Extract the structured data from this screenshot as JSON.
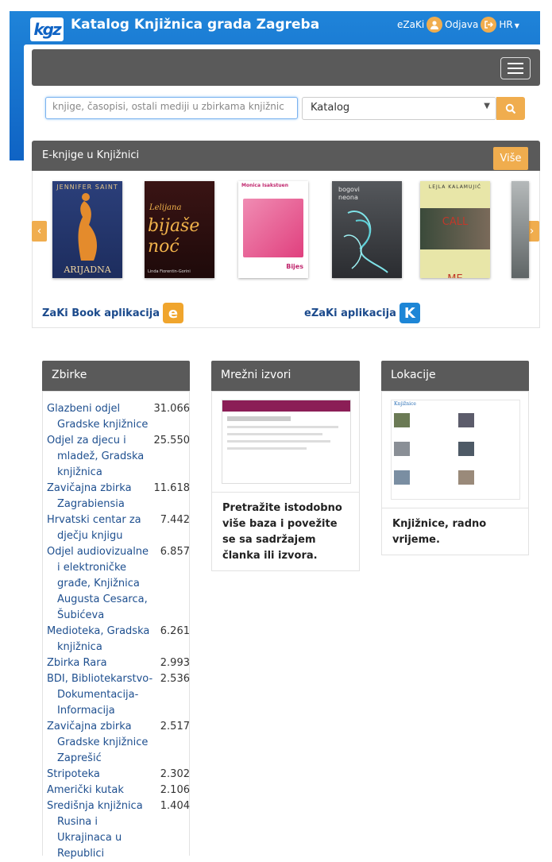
{
  "header": {
    "logo_text": "kgz",
    "title": "Katalog Knjižnica grada Zagreba",
    "user_link": "eZaKi",
    "logout": "Odjava",
    "language": "HR"
  },
  "search": {
    "placeholder": "knjige, časopisi, ostali mediji u zbirkama knjižnic",
    "scope_selected": "Katalog"
  },
  "ebooks": {
    "heading": "E-knjige u Knjižnici",
    "more_label": "Više",
    "books": [
      {
        "title": "ARIJADNA",
        "author": "JENNIFER SAINT"
      },
      {
        "title": "bijaše noć",
        "author": "Linda Fiorentin-Gorini",
        "top": "Lelijana"
      },
      {
        "title": "Bijes",
        "author": "Monica Isakstuen"
      },
      {
        "title": "bogovi neona",
        "author": ""
      },
      {
        "title": "CALL ME ESTEBAN",
        "author": "LEJLA KALAMUJIĆ"
      }
    ]
  },
  "apps": {
    "zaki_book": "ZaKi Book aplikacija",
    "ezaki": "eZaKi aplikacija"
  },
  "zbirke": {
    "heading": "Zbirke",
    "items": [
      {
        "name": "Glazbeni odjel Gradske knjižnice",
        "count": "31.066"
      },
      {
        "name": "Odjel za djecu i mladež, Gradska knjižnica",
        "count": "25.550"
      },
      {
        "name": "Zavičajna zbirka Zagrabiensia",
        "count": "11.618"
      },
      {
        "name": "Hrvatski centar za dječju knjigu",
        "count": "7.442"
      },
      {
        "name": "Odjel audiovizualne i elektroničke građe, Knjižnica Augusta Cesarca, Šubićeva",
        "count": "6.857"
      },
      {
        "name": "Medioteka, Gradska knjižnica",
        "count": "6.261"
      },
      {
        "name": "Zbirka Rara",
        "count": "2.993"
      },
      {
        "name": "BDI, Bibliotekarstvo-Dokumentacija-Informacija",
        "count": "2.536"
      },
      {
        "name": "Zavičajna zbirka Gradske knjižnice Zaprešić",
        "count": "2.517"
      },
      {
        "name": "Stripoteka",
        "count": "2.302"
      },
      {
        "name": "Američki kutak",
        "count": "2.106"
      },
      {
        "name": "Središnja knjižnica Rusina i Ukrajinaca u Republici",
        "count": "1.404"
      }
    ]
  },
  "mrezni": {
    "heading": "Mrežni izvori",
    "caption": "Pretražite istodobno više baza i povežite se sa sadržajem članka ili izvora."
  },
  "lokacije": {
    "heading": "Lokacije",
    "thumb_title": "Knjižnice",
    "caption": "Knjižnice, radno vrijeme."
  }
}
